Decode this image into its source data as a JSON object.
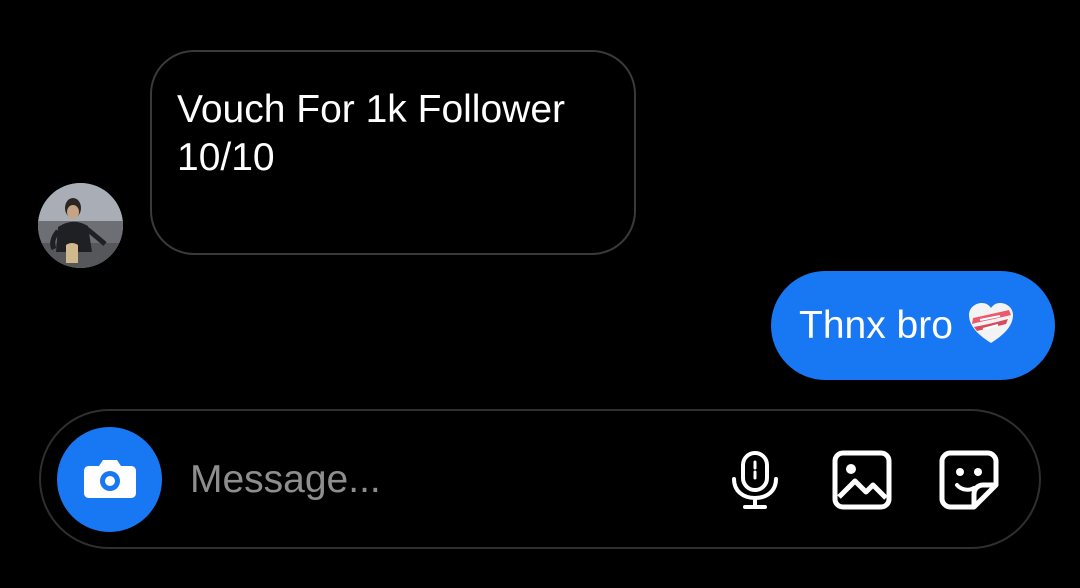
{
  "thread": {
    "messages": [
      {
        "direction": "incoming",
        "text": "Vouch For 1k Follower\n10/10"
      },
      {
        "direction": "outgoing",
        "text": "Thnx bro",
        "emoji_icon": "mending-heart-icon"
      }
    ]
  },
  "composer": {
    "placeholder": "Message...",
    "value": "",
    "icons": [
      "camera-icon",
      "microphone-icon",
      "gallery-icon",
      "sticker-icon"
    ]
  },
  "colors": {
    "background": "#000000",
    "accent": "#1877f2",
    "text": "#ffffff",
    "placeholder": "#8e8e8e",
    "border": "#3a3a3a"
  }
}
